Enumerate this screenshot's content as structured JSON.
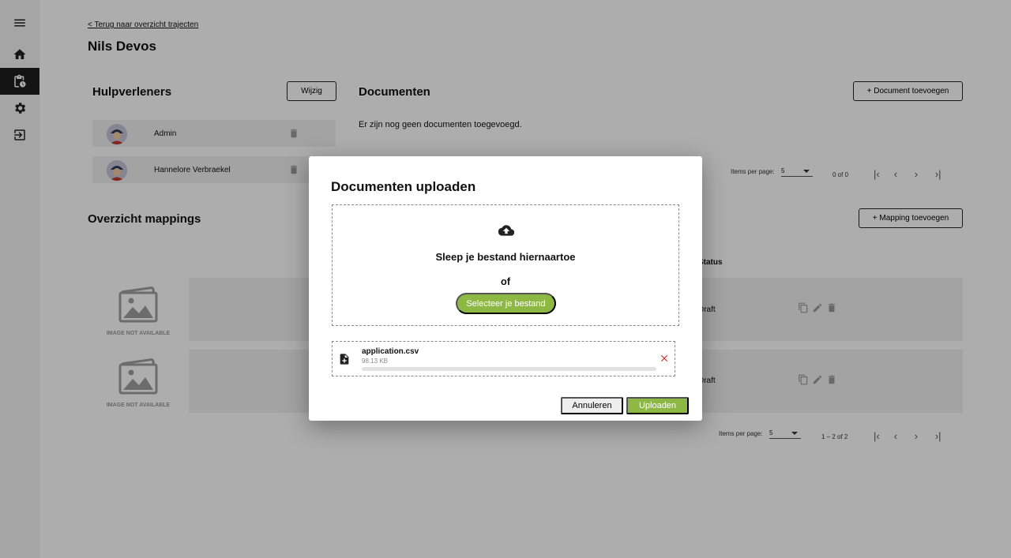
{
  "sidebar": {
    "items": [
      {
        "icon": "menu-icon"
      },
      {
        "icon": "home-icon"
      },
      {
        "icon": "clipboard-icon",
        "active": true
      },
      {
        "icon": "gear-icon"
      },
      {
        "icon": "logout-icon"
      }
    ]
  },
  "header": {
    "back_link": "< Terug naar overzicht trajecten",
    "title": "Nils Devos"
  },
  "hulpverleners": {
    "title": "Hulpverleners",
    "edit_label": "Wijzig",
    "items": [
      {
        "name": "Admin"
      },
      {
        "name": "Hannelore Verbraekel"
      }
    ]
  },
  "documenten": {
    "title": "Documenten",
    "add_label": "+ Document toevoegen",
    "empty_text": "Er zijn nog geen documenten toegevoegd.",
    "pager": {
      "items_per_page_label": "Items per page:",
      "page_size": "5",
      "range": "0 of 0"
    }
  },
  "mappings": {
    "title": "Overzicht mappings",
    "add_label": "+ Mapping toevoegen",
    "status_header": "Status",
    "image_placeholder": "IMAGE NOT AVAILABLE",
    "rows": [
      {
        "status": "Draft"
      },
      {
        "status": "Draft"
      }
    ],
    "pager": {
      "items_per_page_label": "Items per page:",
      "page_size": "5",
      "range": "1 – 2 of 2"
    }
  },
  "dialog": {
    "title": "Documenten uploaden",
    "drop_text": "Sleep je bestand hiernaartoe",
    "or_text": "of",
    "select_label": "Selecteer je bestand",
    "file": {
      "name": "application.csv",
      "size": "98.13 KB",
      "progress": 0
    },
    "cancel_label": "Annuleren",
    "upload_label": "Uploaden"
  },
  "colors": {
    "accent": "#8db843",
    "close": "#c0392b"
  }
}
